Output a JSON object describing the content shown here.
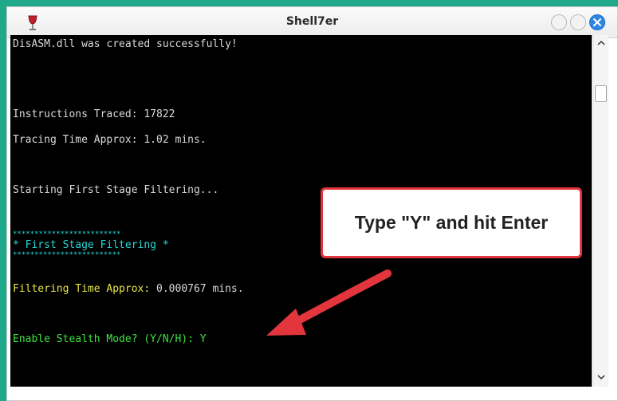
{
  "window": {
    "title": "Shell7er",
    "app_icon": "wine-glass-icon",
    "controls": [
      "minimize-icon",
      "maximize-icon",
      "close-icon"
    ]
  },
  "terminal": {
    "lines": [
      {
        "text": "DisASM.dll was created successfully!",
        "color": "#d9d9d9"
      },
      {
        "text": "Instructions Traced: 17822",
        "color": "#d9d9d9"
      },
      {
        "text": "Tracing Time Approx: 1.02 mins.",
        "color": "#d9d9d9"
      },
      {
        "text": "Starting First Stage Filtering...",
        "color": "#d9d9d9"
      },
      {
        "text": "*************************",
        "color": "#28d7d7"
      },
      {
        "text": "* First Stage Filtering *",
        "color": "#28d7d7"
      },
      {
        "text": "*************************",
        "color": "#28d7d7"
      },
      {
        "label": "Filtering Time Approx:",
        "value": " 0.000767 mins.",
        "color": "#e8e84a"
      },
      {
        "text": "Enable Stealth Mode? (Y/N/H): Y",
        "color": "#3ee23e"
      }
    ]
  },
  "callout": {
    "text": "Type \"Y\" and hit Enter",
    "border_color": "#e2353c",
    "arrow_color": "#e2353c"
  },
  "scrollbar": {
    "up_icon": "chevron-up-icon",
    "down_icon": "chevron-down-icon"
  }
}
